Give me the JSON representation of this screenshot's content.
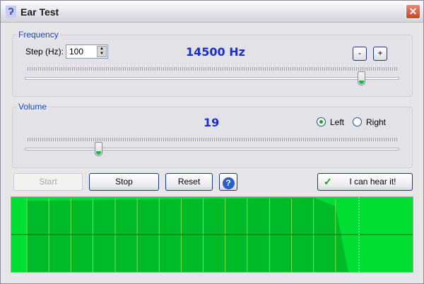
{
  "window": {
    "title": "Ear Test",
    "close_label": "✕"
  },
  "frequency": {
    "group_label": "Frequency",
    "step_label": "Step (Hz):",
    "step_value": "100",
    "display": "14500 Hz",
    "minus_label": "-",
    "plus_label": "+",
    "slider_fraction": 0.9
  },
  "volume": {
    "group_label": "Volume",
    "display": "19",
    "slider_fraction": 0.19,
    "left_label": "Left",
    "right_label": "Right",
    "selected_channel": "Left"
  },
  "buttons": {
    "start": "Start",
    "stop": "Stop",
    "reset": "Reset",
    "help": "?",
    "hear": "I can hear it!",
    "check": "✓"
  },
  "graph": {
    "background": "#00dd33",
    "bar_color": "#00bb28",
    "line_color": "#7fe04a",
    "bar_lines": [
      0,
      0.057,
      0.114,
      0.171,
      0.229,
      0.286,
      0.343,
      0.4,
      0.457,
      0.514,
      0.571,
      0.629,
      0.686,
      0.743,
      0.8
    ],
    "curve": [
      [
        0,
        0.95
      ],
      [
        0.743,
        0.99
      ],
      [
        0.8,
        0.88
      ],
      [
        0.833,
        0
      ]
    ],
    "marker_fraction": 0.866
  }
}
